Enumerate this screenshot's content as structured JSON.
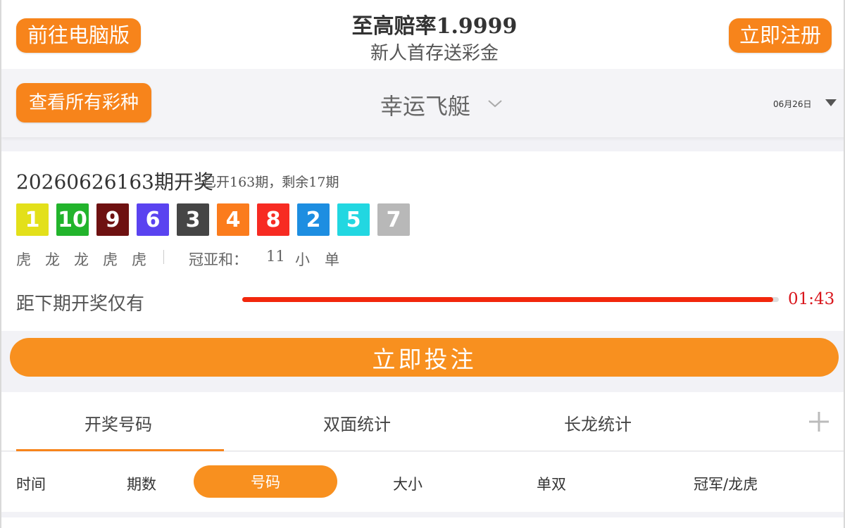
{
  "header": {
    "pc_button": "前往电脑版",
    "title": "至高赔率1.9999",
    "subtitle": "新人首存送彩金",
    "register_button": "立即注册"
  },
  "lottery_bar": {
    "all_button": "查看所有彩种",
    "name": "幸运飞艇",
    "date": "06月26日"
  },
  "result": {
    "period": "20260626163期开奖",
    "info": "已开163期，剩余17期",
    "balls": [
      {
        "num": "1",
        "color": "#e3e01a"
      },
      {
        "num": "10",
        "color": "#22b42c"
      },
      {
        "num": "9",
        "color": "#6e1111"
      },
      {
        "num": "6",
        "color": "#5a43f0"
      },
      {
        "num": "3",
        "color": "#454545"
      },
      {
        "num": "4",
        "color": "#fb7c1d"
      },
      {
        "num": "8",
        "color": "#f72b22"
      },
      {
        "num": "2",
        "color": "#1d8ee1"
      },
      {
        "num": "5",
        "color": "#22d7e1"
      },
      {
        "num": "7",
        "color": "#b8b8b8"
      }
    ],
    "dragon_tiger": [
      "虎",
      "龙",
      "龙",
      "虎",
      "虎"
    ],
    "sum_label": "冠亚和：",
    "sum_value": "11",
    "sum_size": "小",
    "sum_odd": "单"
  },
  "countdown": {
    "label": "距下期开奖仅有",
    "time": "01:43",
    "progress": 0.99
  },
  "bet_button": "立即投注",
  "tabs": [
    {
      "label": "开奖号码",
      "active": true
    },
    {
      "label": "双面统计",
      "active": false
    },
    {
      "label": "长龙统计",
      "active": false
    }
  ],
  "subtabs": [
    "时间",
    "期数",
    "号码",
    "大小",
    "单双",
    "冠军/龙虎"
  ],
  "colors": {
    "accent": "#f7841b",
    "countdown": "#d9161c",
    "progress": "#f2270c"
  }
}
